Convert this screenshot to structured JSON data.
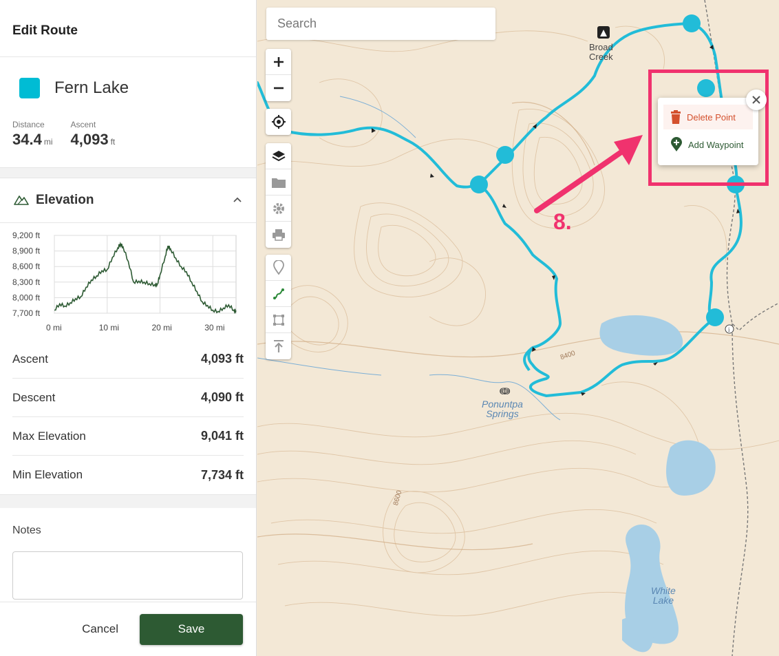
{
  "header": {
    "title": "Edit Route"
  },
  "route": {
    "name": "Fern Lake",
    "color": "#00bcd4",
    "distance": {
      "label": "Distance",
      "value": "34.4",
      "unit": "mi"
    },
    "ascent": {
      "label": "Ascent",
      "value": "4,093",
      "unit": "ft"
    }
  },
  "elevation": {
    "title": "Elevation",
    "chart_data": {
      "type": "line",
      "title": "",
      "xlabel": "",
      "ylabel": "",
      "y_ticks": [
        "9,200 ft",
        "8,900 ft",
        "8,600 ft",
        "8,300 ft",
        "8,000 ft",
        "7,700 ft"
      ],
      "x_ticks": [
        "0 mi",
        "10 mi",
        "20 mi",
        "30 mi"
      ],
      "xlim": [
        0,
        34.4
      ],
      "ylim": [
        7700,
        9200
      ],
      "grid": true,
      "series": [
        {
          "color": "#2d5a33",
          "x": [
            0,
            1,
            2,
            3,
            4,
            5,
            6,
            7,
            8,
            9,
            10,
            11,
            12,
            12.5,
            13,
            14,
            15,
            16,
            17,
            18,
            19,
            19.5,
            20,
            21,
            21.5,
            22,
            23,
            24,
            25,
            26,
            27,
            28,
            29,
            30,
            31,
            32,
            33,
            34,
            34.4
          ],
          "y": [
            7760,
            7880,
            7840,
            7900,
            7980,
            8020,
            8200,
            8340,
            8420,
            8520,
            8540,
            8780,
            8960,
            9041,
            8980,
            8700,
            8300,
            8320,
            8300,
            8270,
            8250,
            8260,
            8440,
            8800,
            9000,
            8940,
            8760,
            8600,
            8500,
            8300,
            8120,
            7920,
            7850,
            7760,
            7734,
            7800,
            7860,
            7760,
            7750
          ]
        }
      ]
    }
  },
  "summary": [
    {
      "key": "Ascent",
      "value": "4,093 ft"
    },
    {
      "key": "Descent",
      "value": "4,090 ft"
    },
    {
      "key": "Max Elevation",
      "value": "9,041 ft"
    },
    {
      "key": "Min Elevation",
      "value": "7,734 ft"
    }
  ],
  "notes": {
    "label": "Notes",
    "value": ""
  },
  "footer": {
    "cancel": "Cancel",
    "save": "Save"
  },
  "map": {
    "search_placeholder": "Search",
    "labels": {
      "broad_creek_1": "Broad",
      "broad_creek_2": "Creek",
      "springs_1": "Ponuntpa",
      "springs_2": "Springs",
      "lake_1": "White",
      "lake_2": "Lake",
      "contour_8400": "8400",
      "contour_8600": "8600"
    },
    "popup": {
      "delete": "Delete Point",
      "add": "Add Waypoint"
    },
    "annotation": "8."
  },
  "colors": {
    "route": "#22bcd8",
    "save_button": "#2d5a33",
    "annotation": "#f0326e",
    "delete": "#d4502d"
  }
}
